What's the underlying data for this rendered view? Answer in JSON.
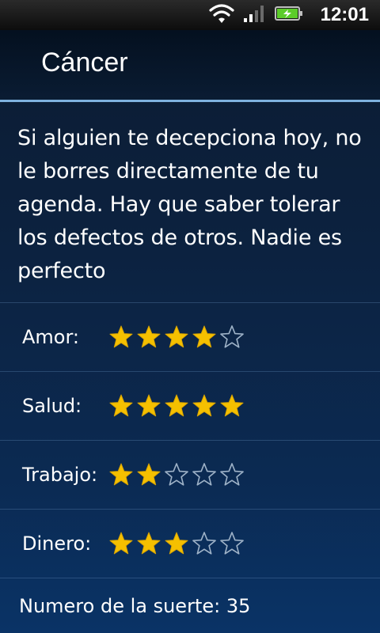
{
  "status_bar": {
    "time": "12:01",
    "icons": [
      "wifi-icon",
      "signal-icon",
      "battery-charging-icon"
    ],
    "battery_color": "#5ccc2a"
  },
  "header": {
    "title": "Cáncer"
  },
  "prediction": {
    "text": "Si alguien te decepciona hoy, no le borres directamente de tu agenda. Hay que saber tolerar los defectos de otros. Nadie es perfecto"
  },
  "ratings": [
    {
      "label": "Amor:",
      "stars": 4,
      "max": 5
    },
    {
      "label": "Salud:",
      "stars": 5,
      "max": 5
    },
    {
      "label": "Trabajo:",
      "stars": 2,
      "max": 5
    },
    {
      "label": "Dinero:",
      "stars": 3,
      "max": 5
    }
  ],
  "lucky": {
    "text": "Numero de la suerte: 35"
  },
  "colors": {
    "star_filled": "#f5c000",
    "star_empty_outline": "#9fb3c8",
    "accent_divider": "#7fb2df"
  }
}
